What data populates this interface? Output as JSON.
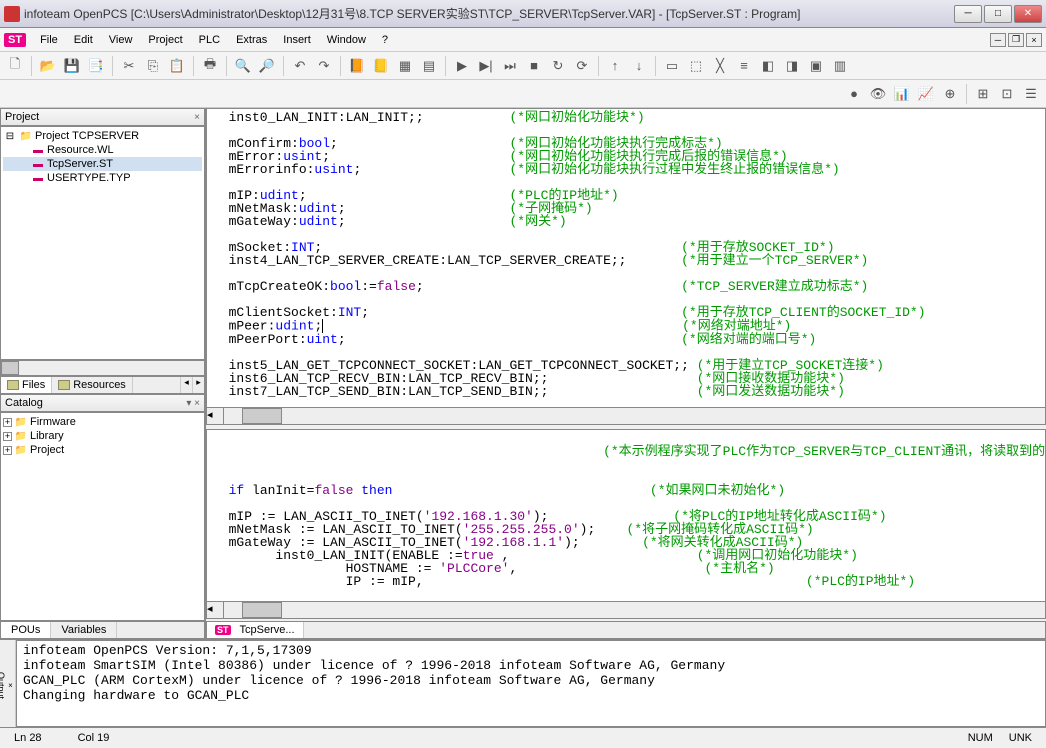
{
  "title": "infoteam OpenPCS [C:\\Users\\Administrator\\Desktop\\12月31号\\8.TCP SERVER实验ST\\TCP_SERVER\\TcpServer.VAR]  -  [TcpServer.ST : Program]",
  "menus": [
    "File",
    "Edit",
    "View",
    "Project",
    "PLC",
    "Extras",
    "Insert",
    "Window",
    "?"
  ],
  "panel_project": "Project",
  "project_tree": {
    "root": "Project TCPSERVER",
    "items": [
      "Resource.WL",
      "TcpServer.ST",
      "USERTYPE.TYP"
    ]
  },
  "tabs_bottom": {
    "files": "Files",
    "resources": "Resources"
  },
  "panel_catalog": "Catalog",
  "catalog_items": [
    "Firmware",
    "Library",
    "Project"
  ],
  "pous_tabs": {
    "pous": "POUs",
    "vars": "Variables"
  },
  "file_tab": "TcpServe...",
  "code_upper": [
    {
      "t": "  inst0_LAN_INIT:LAN_INIT;",
      "c": "(*网口初始化功能块*)"
    },
    {
      "t": "",
      "c": ""
    },
    {
      "t": "  mConfirm:",
      "ty": "bool",
      "c": "(*网口初始化功能块执行完成标志*)"
    },
    {
      "t": "  mError:",
      "ty": "usint",
      "c": "(*网口初始化功能块执行完成后报的错误信息*)"
    },
    {
      "t": "  mErrorinfo:",
      "ty": "usint",
      "c": "(*网口初始化功能块执行过程中发生终止报的错误信息*)"
    },
    {
      "t": "",
      "c": ""
    },
    {
      "t": "  mIP:",
      "ty": "udint",
      "c": "(*PLC的IP地址*)"
    },
    {
      "t": "  mNetMask:",
      "ty": "udint",
      "c": "(*子网掩码*)"
    },
    {
      "t": "  mGateWay:",
      "ty": "udint",
      "c": "(*网关*)"
    },
    {
      "t": "",
      "c": ""
    },
    {
      "t": "  mSocket:",
      "ty": "INT",
      "c2": "(*用于存放SOCKET_ID*)"
    },
    {
      "t": "  inst4_LAN_TCP_SERVER_CREATE:LAN_TCP_SERVER_CREATE;",
      "c2": "(*用于建立一个TCP_SERVER*)"
    },
    {
      "t": "",
      "c": ""
    },
    {
      "t": "  mTcpCreateOK:",
      "ty": "bool",
      "asgn": ":=",
      "val": "false",
      "c2": "(*TCP_SERVER建立成功标志*)"
    },
    {
      "t": "",
      "c": ""
    },
    {
      "t": "  mClientSocket:",
      "ty": "INT",
      "c2": "(*用于存放TCP_CLIENT的SOCKET_ID*)"
    },
    {
      "t": "  mPeer:",
      "ty": "udint",
      "caret": true,
      "c2": "(*网络对端地址*)"
    },
    {
      "t": "  mPeerPort:",
      "ty": "uint",
      "c2": "(*网络对端的端口号*)"
    },
    {
      "t": "",
      "c": ""
    },
    {
      "t": "  inst5_LAN_GET_TCPCONNECT_SOCKET:LAN_GET_TCPCONNECT_SOCKET;",
      "c2b": "(*用于建立TCP_SOCKET连接*)"
    },
    {
      "t": "  inst6_LAN_TCP_RECV_BIN:LAN_TCP_RECV_BIN;",
      "c2b": "(*网口接收数据功能块*)"
    },
    {
      "t": "  inst7_LAN_TCP_SEND_BIN:LAN_TCP_SEND_BIN;",
      "c2b": "(*网口发送数据功能块*)"
    }
  ],
  "code_lower": [
    {
      "raw": "",
      "c": ""
    },
    {
      "raw": "  ",
      "c": "(*本示例程序实现了PLC作为TCP_SERVER与TCP_CLIENT通讯，将读取到的数据原样发送出去*)"
    },
    {
      "raw": "",
      "c": ""
    },
    {
      "raw": "",
      "c": ""
    },
    {
      "k1": "if",
      "mid": " lanInit=",
      "val": "false",
      "k2": " then",
      "c": "      (*如果网口未初始化*)"
    },
    {
      "raw": "",
      "c": ""
    },
    {
      "plain": "  mIP := LAN_ASCII_TO_INET(",
      "s": "'192.168.1.30'",
      "tail": ");",
      "c": "         (*将PLC的IP地址转化成ASCII码*)"
    },
    {
      "plain": "  mNetMask := LAN_ASCII_TO_INET(",
      "s": "'255.255.255.0'",
      "tail": ");",
      "c": "   (*将子网掩码转化成ASCII码*)"
    },
    {
      "plain": "  mGateWay := LAN_ASCII_TO_INET(",
      "s": "'192.168.1.1'",
      "tail": ");",
      "c": "     (*将网关转化成ASCII码*)"
    },
    {
      "plain": "        inst0_LAN_INIT(ENABLE :=",
      "val": "true",
      "tail": " ,",
      "c": "            (*调用网口初始化功能块*)"
    },
    {
      "plain": "                 HOSTNAME := ",
      "s": "'PLCCore'",
      "tail": ",",
      "c": "             (*主机名*)"
    },
    {
      "plain": "                 IP := mIP,",
      "c": "                          (*PLC的IP地址*)"
    }
  ],
  "output_label": "Output",
  "output_lines": [
    "infoteam OpenPCS Version: 7,1,5,17309",
    "infoteam SmartSIM (Intel 80386) under licence of ? 1996-2018 infoteam Software AG, Germany",
    "GCAN_PLC (ARM CortexM) under licence of ? 1996-2018 infoteam Software AG, Germany",
    "Changing hardware to GCAN_PLC"
  ],
  "status": {
    "ln_label": "Ln",
    "ln": "28",
    "col_label": "Col",
    "col": "19",
    "num": "NUM",
    "unk": "UNK"
  }
}
